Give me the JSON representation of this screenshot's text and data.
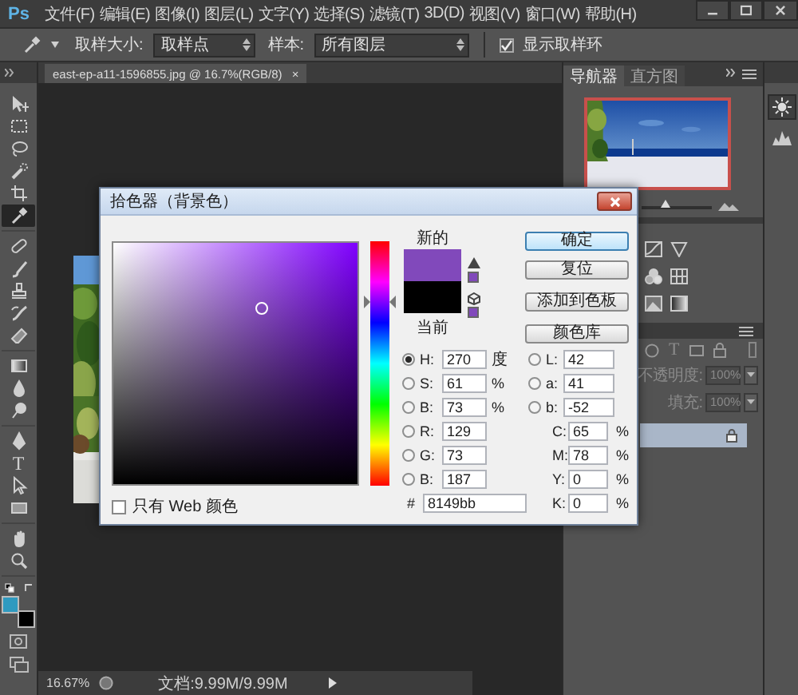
{
  "app": {
    "logo": "Ps"
  },
  "menu": [
    "文件(F)",
    "编辑(E)",
    "图像(I)",
    "图层(L)",
    "文字(Y)",
    "选择(S)",
    "滤镜(T)",
    "3D(D)",
    "视图(V)",
    "窗口(W)",
    "帮助(H)"
  ],
  "options_bar": {
    "sample_size_label": "取样大小:",
    "sample_size": "取样点",
    "sample_label": "样本:",
    "sample": "所有图层",
    "show_ring": {
      "label": "显示取样环",
      "checked": true
    }
  },
  "document_tab": {
    "title": "east-ep-a11-1596855.jpg @ 16.7%(RGB/8)",
    "close": "×"
  },
  "tool_groups": [
    {
      "tools": [
        {
          "kind": "move",
          "selected": false
        },
        {
          "kind": "marquee",
          "selected": false
        },
        {
          "kind": "lasso",
          "selected": false
        },
        {
          "kind": "quick_select",
          "selected": false
        },
        {
          "kind": "crop",
          "selected": false
        },
        {
          "kind": "eyedropper",
          "selected": true
        }
      ]
    },
    {
      "tools": [
        {
          "kind": "healing",
          "selected": false
        },
        {
          "kind": "brush",
          "selected": false
        },
        {
          "kind": "stamp",
          "selected": false
        },
        {
          "kind": "history_brush",
          "selected": false
        },
        {
          "kind": "eraser",
          "selected": false
        }
      ]
    },
    {
      "tools": [
        {
          "kind": "gradient",
          "selected": false
        },
        {
          "kind": "blur",
          "selected": false
        },
        {
          "kind": "dodge",
          "selected": false
        }
      ]
    },
    {
      "tools": [
        {
          "kind": "pen",
          "selected": false
        },
        {
          "kind": "type",
          "glyph": "T",
          "selected": false
        },
        {
          "kind": "path_select",
          "selected": false
        },
        {
          "kind": "rectangle",
          "selected": false
        }
      ]
    },
    {
      "tools": [
        {
          "kind": "hand",
          "selected": false
        },
        {
          "kind": "zoom",
          "selected": false
        }
      ]
    }
  ],
  "swatches": [
    {
      "kind": "foreground",
      "color": "#2f9ac0"
    },
    {
      "kind": "background",
      "color": "#000000"
    }
  ],
  "status_bar": {
    "zoom": "16.67%",
    "doc_info": "文档:9.99M/9.99M"
  },
  "navigator": {
    "tabs": [
      {
        "label": "导航器",
        "selected": true
      },
      {
        "label": "直方图",
        "selected": false
      }
    ],
    "zoom_slider": {
      "level": 0.33
    }
  },
  "layers_panel": {
    "filter_type_glyph": "T",
    "opacity_label": "不透明度:",
    "opacity": "100%",
    "fill_label": "填充:",
    "fill": "100%",
    "disabled": true,
    "layers": [
      {
        "selected": true,
        "locked": true
      }
    ]
  },
  "color_picker": {
    "title": "拾色器（背景色）",
    "swatches": [
      {
        "kind": "new",
        "label": "新的",
        "color": "#8149bb"
      },
      {
        "kind": "current",
        "label": "当前",
        "color": "#000000"
      }
    ],
    "hue_slider": {
      "level": 0.75
    },
    "buttons": [
      {
        "label": "确定",
        "default": true
      },
      {
        "label": "复位",
        "default": false
      },
      {
        "label": "添加到色板",
        "default": false
      },
      {
        "label": "颜色库",
        "default": false
      }
    ],
    "hsb": [
      {
        "label": "H:",
        "value": "270",
        "unit": "度",
        "selected": true
      },
      {
        "label": "S:",
        "value": "61",
        "unit": "%",
        "selected": false
      },
      {
        "label": "B:",
        "value": "73",
        "unit": "%",
        "selected": false
      }
    ],
    "rgb": [
      {
        "label": "R:",
        "value": "129",
        "selected": false
      },
      {
        "label": "G:",
        "value": "73",
        "selected": false
      },
      {
        "label": "B:",
        "value": "187",
        "selected": false
      }
    ],
    "hex": {
      "label": "#",
      "value": "8149bb"
    },
    "lab": [
      {
        "label": "L:",
        "value": "42",
        "selected": false
      },
      {
        "label": "a:",
        "value": "41",
        "selected": false
      },
      {
        "label": "b:",
        "value": "-52",
        "selected": false
      }
    ],
    "cmyk": [
      {
        "label": "C:",
        "value": "65",
        "unit": "%"
      },
      {
        "label": "M:",
        "value": "78",
        "unit": "%"
      },
      {
        "label": "Y:",
        "value": "0",
        "unit": "%"
      },
      {
        "label": "K:",
        "value": "0",
        "unit": "%"
      }
    ],
    "web_only": {
      "label": "只有 Web 颜色",
      "checked": false
    }
  }
}
